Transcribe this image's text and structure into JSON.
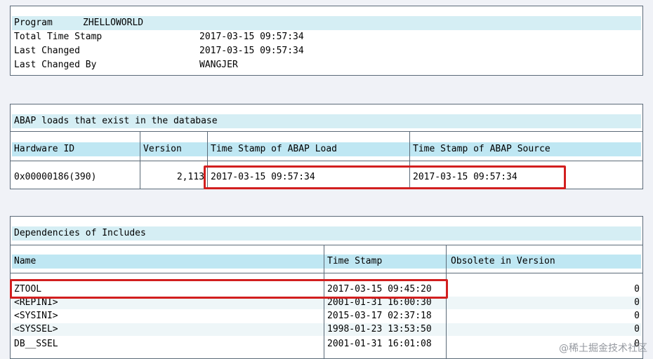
{
  "program_box": {
    "program_label": "Program",
    "program_value": "ZHELLOWORLD",
    "rows": [
      {
        "label": "Total Time Stamp",
        "value": "2017-03-15 09:57:34"
      },
      {
        "label": "Last Changed",
        "value": "2017-03-15 09:57:34"
      },
      {
        "label": "Last Changed By",
        "value": "WANGJER"
      }
    ]
  },
  "loads_box": {
    "title": "ABAP loads that exist in the database",
    "columns": [
      "Hardware ID",
      "Version",
      "Time Stamp of ABAP Load",
      "Time Stamp of ABAP Source"
    ],
    "row": {
      "hardware_id": "0x00000186(390)",
      "version": "2,113",
      "load_ts": "2017-03-15 09:57:34",
      "source_ts": "2017-03-15 09:57:34"
    }
  },
  "deps_box": {
    "title": "Dependencies of Includes",
    "columns": [
      "Name",
      "Time Stamp",
      "Obsolete in Version"
    ],
    "rows": [
      {
        "name": "ZTOOL",
        "ts": "2017-03-15 09:45:20",
        "obsolete": "0"
      },
      {
        "name": "<REPINI>",
        "ts": "2001-01-31 16:00:30",
        "obsolete": "0"
      },
      {
        "name": "<SYSINI>",
        "ts": "2015-03-17 02:37:18",
        "obsolete": "0"
      },
      {
        "name": "<SYSSEL>",
        "ts": "1998-01-23 13:53:50",
        "obsolete": "0"
      },
      {
        "name": "DB__SSEL",
        "ts": "2001-01-31 16:01:08",
        "obsolete": "0"
      }
    ]
  },
  "watermark": "@稀土掘金技术社区",
  "colors": {
    "header_bg": "#d5eef4",
    "highlight_border": "#d21f1f",
    "frame": "#5b6a78"
  }
}
